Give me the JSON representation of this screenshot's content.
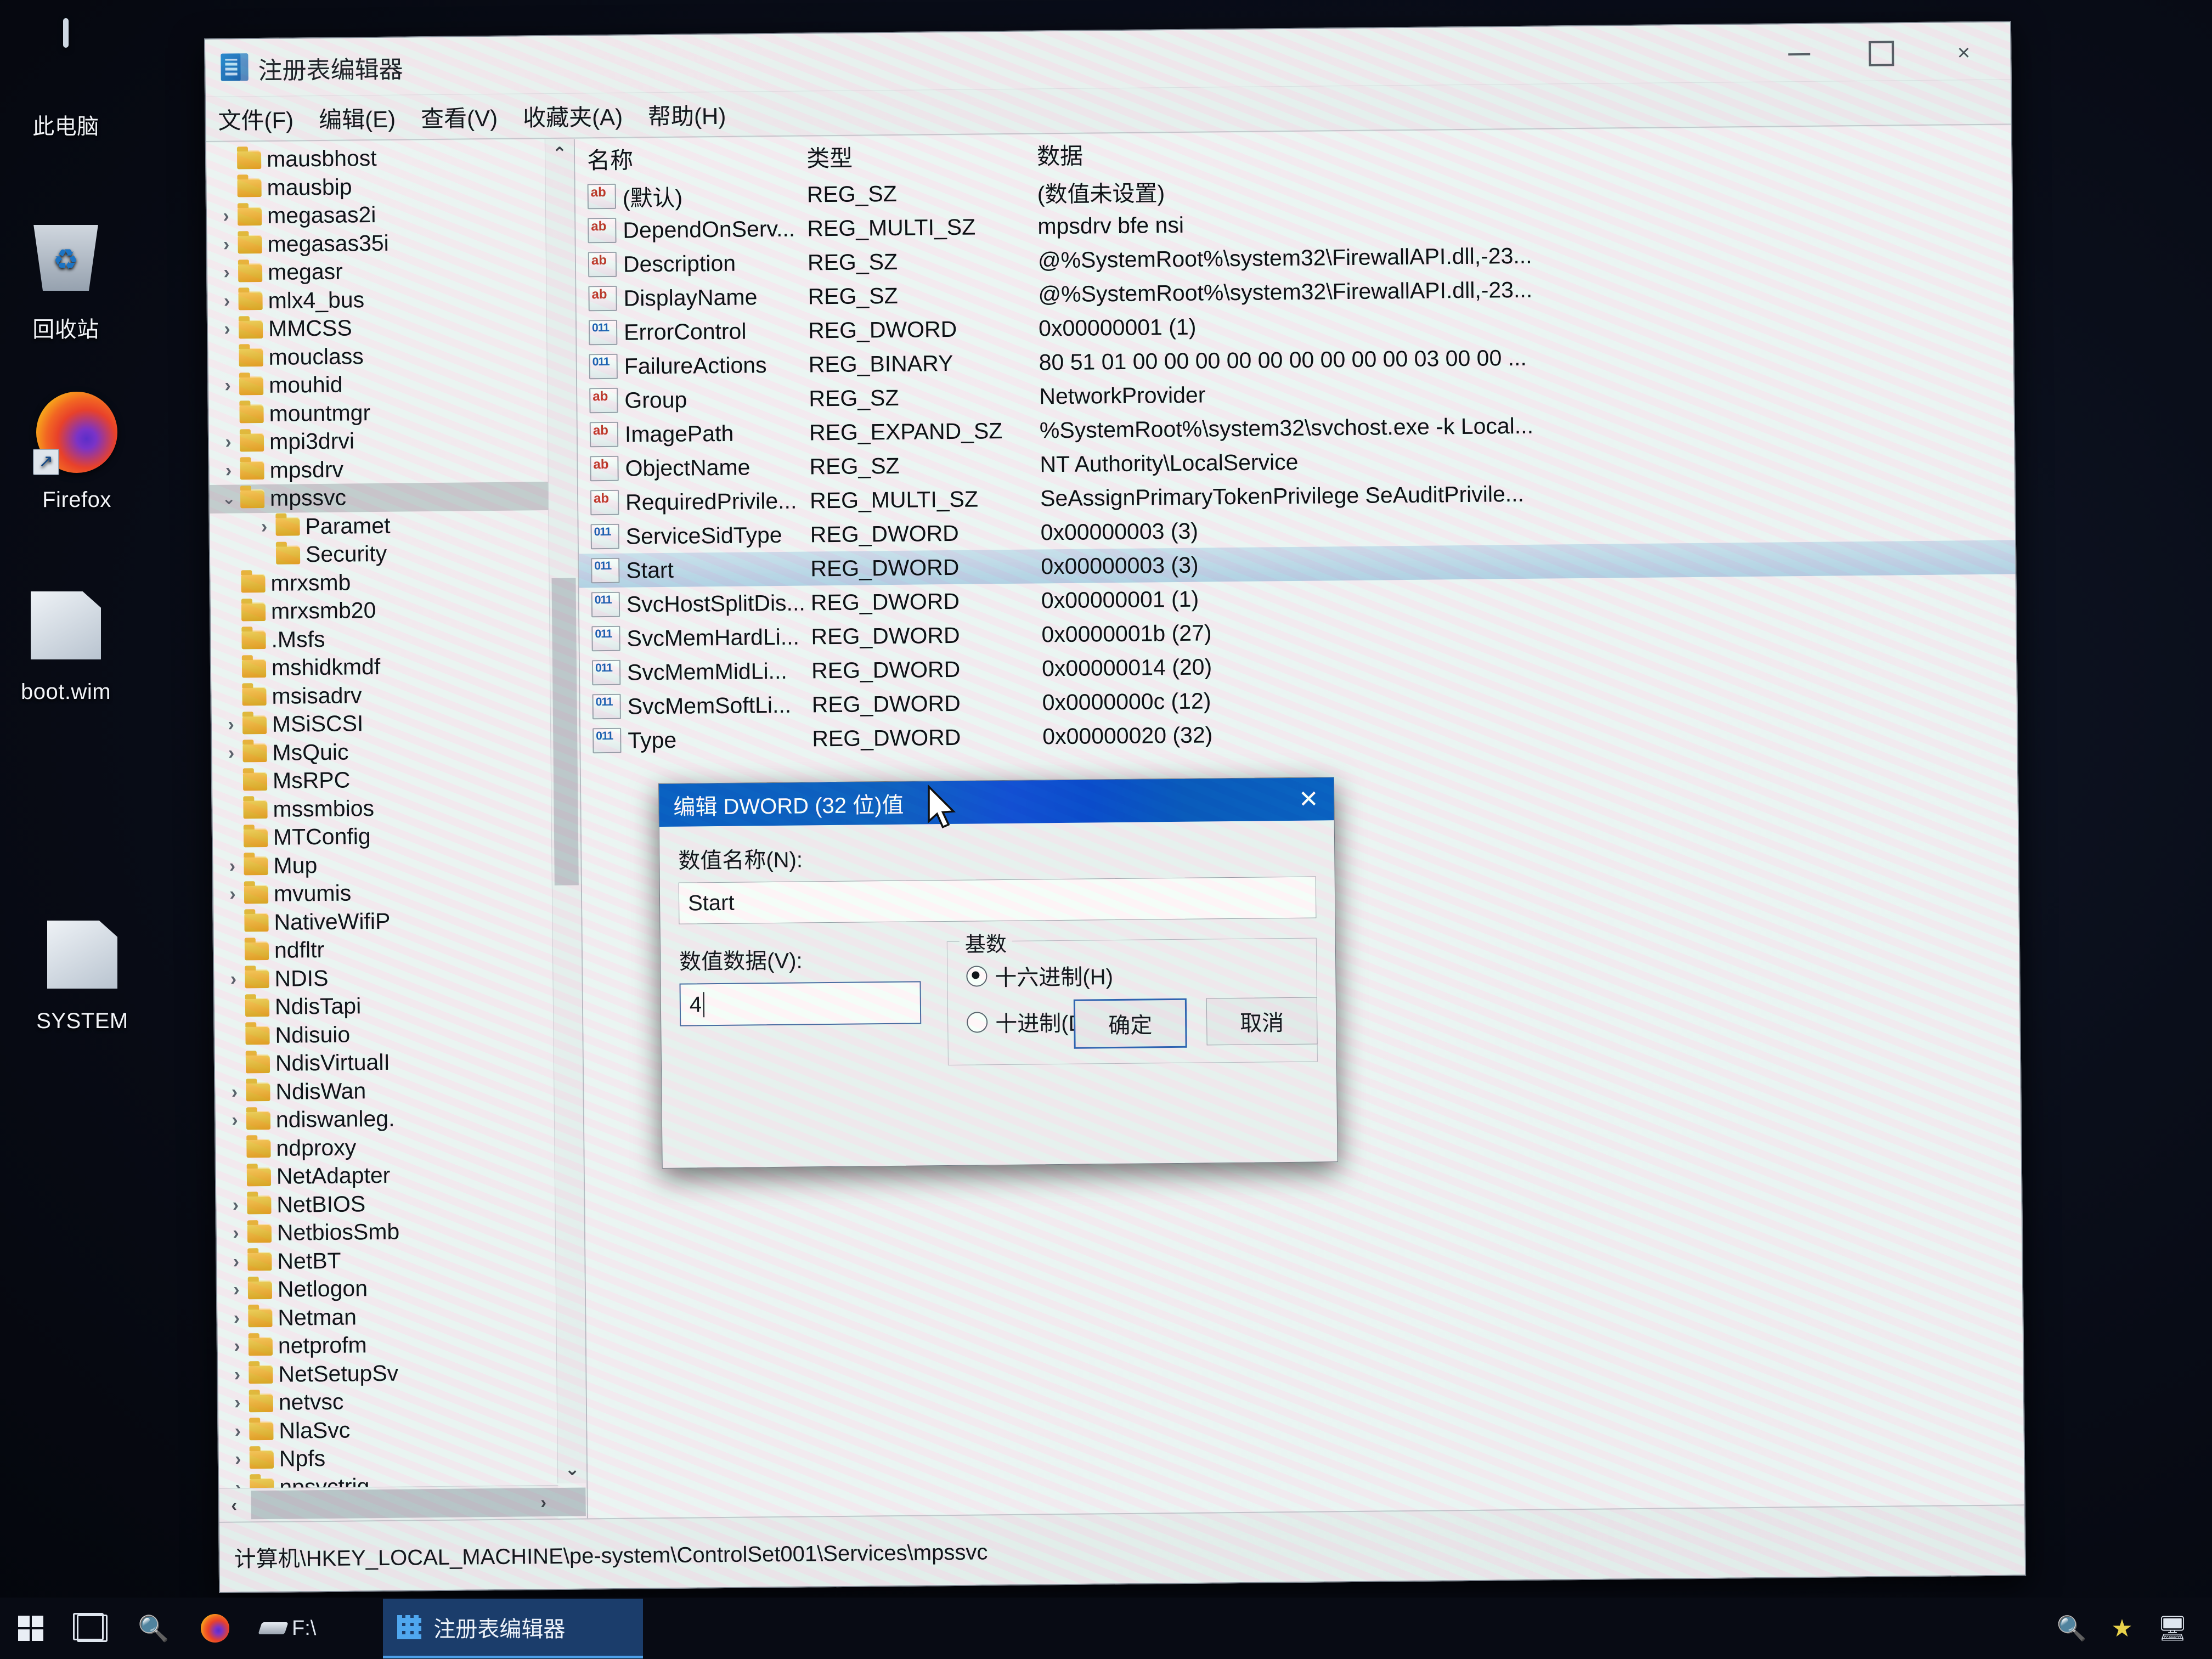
{
  "desktop": {
    "icons": [
      {
        "label": "此电脑",
        "icon": "computer-icon"
      },
      {
        "label": "回收站",
        "icon": "recycle-bin-icon"
      },
      {
        "label": "Firefox",
        "icon": "firefox-icon"
      },
      {
        "label": "boot.wim",
        "icon": "file-icon"
      },
      {
        "label": "SYSTEM",
        "icon": "file-icon"
      }
    ]
  },
  "window": {
    "title": "注册表编辑器",
    "icon": "regedit-icon",
    "menu": [
      "文件(F)",
      "编辑(E)",
      "查看(V)",
      "收藏夹(A)",
      "帮助(H)"
    ],
    "controls": {
      "minimize": "minimize-icon",
      "maximize": "maximize-icon",
      "close": "×"
    },
    "status_path": "计算机\\HKEY_LOCAL_MACHINE\\pe-system\\ControlSet001\\Services\\mpssvc"
  },
  "tree": {
    "scroll_up": "⌃",
    "scroll_down": "⌄",
    "scroll_left": "‹",
    "scroll_right": "›",
    "items": [
      {
        "label": "mausbhost",
        "expander": "",
        "indent": 0
      },
      {
        "label": "mausbip",
        "expander": "",
        "indent": 0
      },
      {
        "label": "megasas2i",
        "expander": "›",
        "indent": 0
      },
      {
        "label": "megasas35i",
        "expander": "›",
        "indent": 0
      },
      {
        "label": "megasr",
        "expander": "›",
        "indent": 0
      },
      {
        "label": "mlx4_bus",
        "expander": "›",
        "indent": 0
      },
      {
        "label": "MMCSS",
        "expander": "›",
        "indent": 0
      },
      {
        "label": "mouclass",
        "expander": "",
        "indent": 0
      },
      {
        "label": "mouhid",
        "expander": "›",
        "indent": 0
      },
      {
        "label": "mountmgr",
        "expander": "",
        "indent": 0
      },
      {
        "label": "mpi3drvi",
        "expander": "›",
        "indent": 0
      },
      {
        "label": "mpsdrv",
        "expander": "›",
        "indent": 0
      },
      {
        "label": "mpssvc",
        "expander": "⌄",
        "indent": 0,
        "selected": true
      },
      {
        "label": "Paramet",
        "expander": "›",
        "indent": 1
      },
      {
        "label": "Security",
        "expander": "",
        "indent": 1
      },
      {
        "label": "mrxsmb",
        "expander": "",
        "indent": 0
      },
      {
        "label": "mrxsmb20",
        "expander": "",
        "indent": 0
      },
      {
        "label": ".Msfs",
        "expander": "",
        "indent": 0
      },
      {
        "label": "mshidkmdf",
        "expander": "",
        "indent": 0
      },
      {
        "label": "msisadrv",
        "expander": "",
        "indent": 0
      },
      {
        "label": "MSiSCSI",
        "expander": "›",
        "indent": 0
      },
      {
        "label": "MsQuic",
        "expander": "›",
        "indent": 0
      },
      {
        "label": "MsRPC",
        "expander": "",
        "indent": 0
      },
      {
        "label": "mssmbios",
        "expander": "",
        "indent": 0
      },
      {
        "label": "MTConfig",
        "expander": "",
        "indent": 0
      },
      {
        "label": "Mup",
        "expander": "›",
        "indent": 0
      },
      {
        "label": "mvumis",
        "expander": "›",
        "indent": 0
      },
      {
        "label": "NativeWifiP",
        "expander": "",
        "indent": 0
      },
      {
        "label": "ndfltr",
        "expander": "",
        "indent": 0
      },
      {
        "label": "NDIS",
        "expander": "›",
        "indent": 0
      },
      {
        "label": "NdisTapi",
        "expander": "",
        "indent": 0
      },
      {
        "label": "Ndisuio",
        "expander": "",
        "indent": 0
      },
      {
        "label": "NdisVirtualI",
        "expander": "",
        "indent": 0
      },
      {
        "label": "NdisWan",
        "expander": "›",
        "indent": 0
      },
      {
        "label": "ndiswanleg.",
        "expander": "›",
        "indent": 0
      },
      {
        "label": "ndproxy",
        "expander": "",
        "indent": 0
      },
      {
        "label": "NetAdapter",
        "expander": "",
        "indent": 0
      },
      {
        "label": "NetBIOS",
        "expander": "›",
        "indent": 0
      },
      {
        "label": "NetbiosSmb",
        "expander": "›",
        "indent": 0
      },
      {
        "label": "NetBT",
        "expander": "›",
        "indent": 0
      },
      {
        "label": "Netlogon",
        "expander": "›",
        "indent": 0
      },
      {
        "label": "Netman",
        "expander": "›",
        "indent": 0
      },
      {
        "label": "netprofm",
        "expander": "›",
        "indent": 0
      },
      {
        "label": "NetSetupSv",
        "expander": "›",
        "indent": 0
      },
      {
        "label": "netvsc",
        "expander": "›",
        "indent": 0
      },
      {
        "label": "NlaSvc",
        "expander": "›",
        "indent": 0
      },
      {
        "label": "Npfs",
        "expander": "›",
        "indent": 0
      },
      {
        "label": "npsvctrig",
        "expander": "›",
        "indent": 0
      }
    ]
  },
  "list": {
    "columns": [
      "名称",
      "类型",
      "数据"
    ],
    "rows": [
      {
        "name": "(默认)",
        "type": "REG_SZ",
        "data": "(数值未设置)",
        "icon": "string-value-icon"
      },
      {
        "name": "DependOnServ...",
        "type": "REG_MULTI_SZ",
        "data": "mpsdrv bfe nsi",
        "icon": "string-value-icon"
      },
      {
        "name": "Description",
        "type": "REG_SZ",
        "data": "@%SystemRoot%\\system32\\FirewallAPI.dll,-23...",
        "icon": "string-value-icon"
      },
      {
        "name": "DisplayName",
        "type": "REG_SZ",
        "data": "@%SystemRoot%\\system32\\FirewallAPI.dll,-23...",
        "icon": "string-value-icon"
      },
      {
        "name": "ErrorControl",
        "type": "REG_DWORD",
        "data": "0x00000001 (1)",
        "icon": "dword-value-icon"
      },
      {
        "name": "FailureActions",
        "type": "REG_BINARY",
        "data": "80 51 01 00 00 00 00 00 00 00 00 00 03 00 00 ...",
        "icon": "dword-value-icon"
      },
      {
        "name": "Group",
        "type": "REG_SZ",
        "data": "NetworkProvider",
        "icon": "string-value-icon"
      },
      {
        "name": "ImagePath",
        "type": "REG_EXPAND_SZ",
        "data": "%SystemRoot%\\system32\\svchost.exe -k Local...",
        "icon": "string-value-icon"
      },
      {
        "name": "ObjectName",
        "type": "REG_SZ",
        "data": "NT Authority\\LocalService",
        "icon": "string-value-icon"
      },
      {
        "name": "RequiredPrivile...",
        "type": "REG_MULTI_SZ",
        "data": "SeAssignPrimaryTokenPrivilege SeAuditPrivile...",
        "icon": "string-value-icon"
      },
      {
        "name": "ServiceSidType",
        "type": "REG_DWORD",
        "data": "0x00000003 (3)",
        "icon": "dword-value-icon"
      },
      {
        "name": "Start",
        "type": "REG_DWORD",
        "data": "0x00000003 (3)",
        "icon": "dword-value-icon",
        "selected": true
      },
      {
        "name": "SvcHostSplitDis...",
        "type": "REG_DWORD",
        "data": "0x00000001 (1)",
        "icon": "dword-value-icon"
      },
      {
        "name": "SvcMemHardLi...",
        "type": "REG_DWORD",
        "data": "0x0000001b (27)",
        "icon": "dword-value-icon"
      },
      {
        "name": "SvcMemMidLi...",
        "type": "REG_DWORD",
        "data": "0x00000014 (20)",
        "icon": "dword-value-icon"
      },
      {
        "name": "SvcMemSoftLi...",
        "type": "REG_DWORD",
        "data": "0x0000000c (12)",
        "icon": "dword-value-icon"
      },
      {
        "name": "Type",
        "type": "REG_DWORD",
        "data": "0x00000020 (32)",
        "icon": "dword-value-icon"
      }
    ]
  },
  "dialog": {
    "title": "编辑 DWORD (32 位)值",
    "close": "✕",
    "name_label": "数值名称(N):",
    "name_value": "Start",
    "data_label": "数值数据(V):",
    "data_value": "4",
    "base_group_label": "基数",
    "radio_hex": "十六进制(H)",
    "radio_dec": "十进制(D)",
    "selected_base": "hex",
    "ok": "确定",
    "cancel": "取消"
  },
  "taskbar": {
    "start": "start-icon",
    "task_view": "task-view-icon",
    "cortana": "cortana-icon",
    "firefox": "firefox-icon",
    "drive_label": "F:\\",
    "active_button": "注册表编辑器",
    "tray": [
      "cortana-icon",
      "star-icon",
      "display-icon"
    ]
  }
}
